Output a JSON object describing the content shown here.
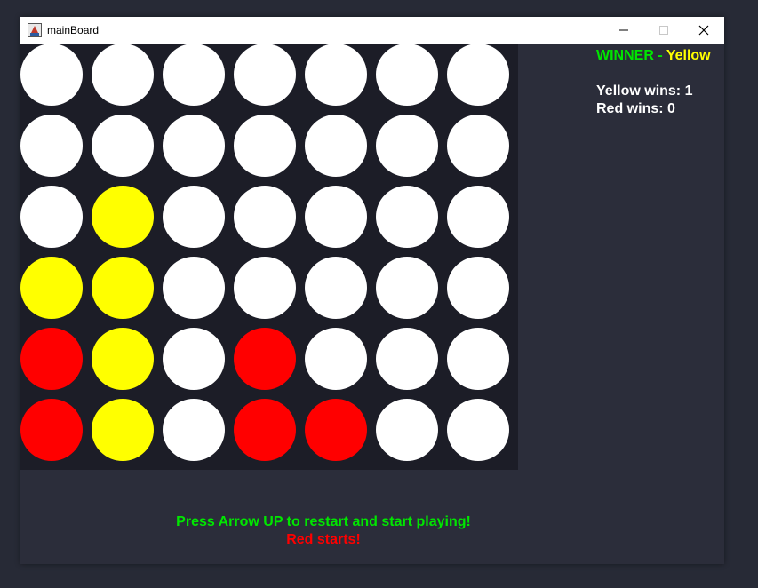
{
  "window": {
    "title": "mainBoard"
  },
  "colors": {
    "background": "#272a36",
    "board": "#1c1d27",
    "empty": "#ffffff",
    "yellow": "#ffff00",
    "red": "#ff0000",
    "green": "#00e600",
    "text": "#ffffff"
  },
  "status": {
    "winner_label": "WINNER -",
    "winner_name": "Yellow",
    "yellow_wins": "Yellow wins: 1",
    "red_wins": "Red wins: 0"
  },
  "messages": {
    "restart": "Press Arrow UP to restart and start playing!",
    "starts": "Red starts!"
  },
  "board": {
    "rows": 6,
    "cols": 7,
    "cells": [
      [
        "empty",
        "empty",
        "empty",
        "empty",
        "empty",
        "empty",
        "empty"
      ],
      [
        "empty",
        "empty",
        "empty",
        "empty",
        "empty",
        "empty",
        "empty"
      ],
      [
        "empty",
        "yellow",
        "empty",
        "empty",
        "empty",
        "empty",
        "empty"
      ],
      [
        "yellow",
        "yellow",
        "empty",
        "empty",
        "empty",
        "empty",
        "empty"
      ],
      [
        "red",
        "yellow",
        "empty",
        "red",
        "empty",
        "empty",
        "empty"
      ],
      [
        "red",
        "yellow",
        "empty",
        "red",
        "red",
        "empty",
        "empty"
      ]
    ]
  }
}
